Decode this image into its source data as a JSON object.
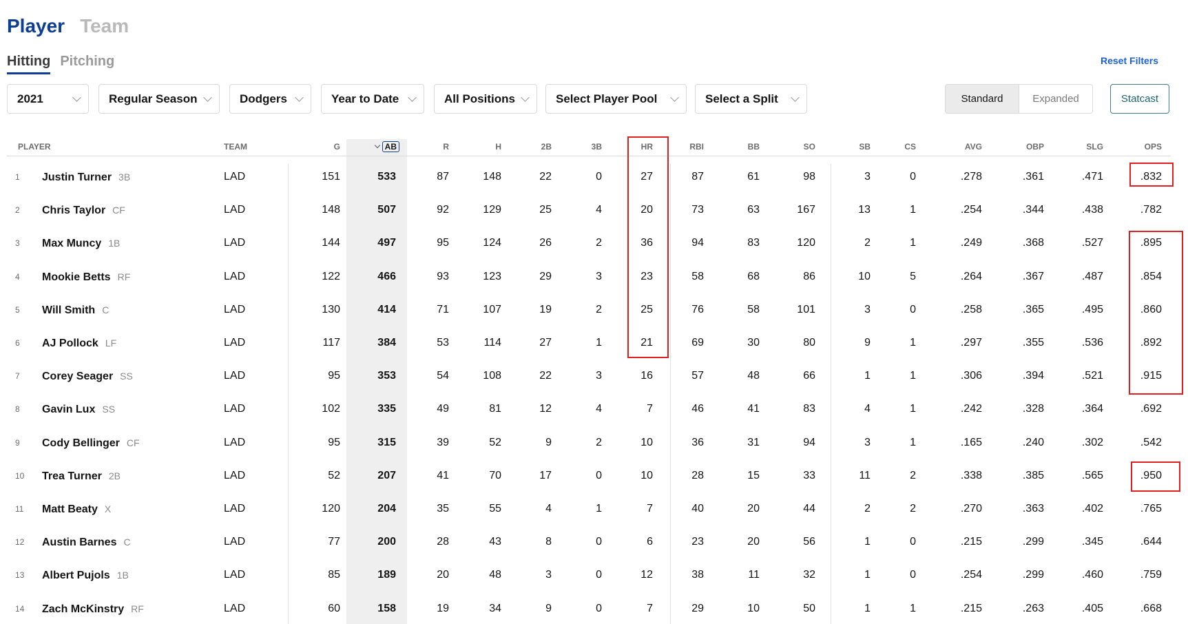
{
  "top_tabs": [
    {
      "label": "Player"
    },
    {
      "label": "Team"
    }
  ],
  "sub_tabs": [
    {
      "label": "Hitting"
    },
    {
      "label": "Pitching"
    }
  ],
  "reset_filters": "Reset Filters",
  "filters": [
    {
      "value": "2021"
    },
    {
      "value": "Regular Season"
    },
    {
      "value": "Dodgers"
    },
    {
      "value": "Year to Date"
    },
    {
      "value": "All Positions"
    },
    {
      "value": "Select Player Pool"
    },
    {
      "value": "Select a Split"
    }
  ],
  "view_toggle": {
    "standard": "Standard",
    "expanded": "Expanded"
  },
  "statcast": "Statcast",
  "columns": {
    "player": "PLAYER",
    "team": "TEAM",
    "g": "G",
    "ab": "AB",
    "r": "R",
    "h": "H",
    "doubles": "2B",
    "triples": "3B",
    "hr": "HR",
    "rbi": "RBI",
    "bb": "BB",
    "so": "SO",
    "sb": "SB",
    "cs": "CS",
    "avg": "AVG",
    "obp": "OBP",
    "slg": "SLG",
    "ops": "OPS"
  },
  "highlight_color": "#e02020",
  "accent_color": "#0d3e94",
  "rows": [
    {
      "rank": "1",
      "name": "Justin Turner",
      "pos": "3B",
      "team": "LAD",
      "g": "151",
      "ab": "533",
      "r": "87",
      "h": "148",
      "doubles": "22",
      "triples": "0",
      "hr": "27",
      "rbi": "87",
      "bb": "61",
      "so": "98",
      "sb": "3",
      "cs": "0",
      "avg": ".278",
      "obp": ".361",
      "slg": ".471",
      "ops": ".832"
    },
    {
      "rank": "2",
      "name": "Chris Taylor",
      "pos": "CF",
      "team": "LAD",
      "g": "148",
      "ab": "507",
      "r": "92",
      "h": "129",
      "doubles": "25",
      "triples": "4",
      "hr": "20",
      "rbi": "73",
      "bb": "63",
      "so": "167",
      "sb": "13",
      "cs": "1",
      "avg": ".254",
      "obp": ".344",
      "slg": ".438",
      "ops": ".782"
    },
    {
      "rank": "3",
      "name": "Max Muncy",
      "pos": "1B",
      "team": "LAD",
      "g": "144",
      "ab": "497",
      "r": "95",
      "h": "124",
      "doubles": "26",
      "triples": "2",
      "hr": "36",
      "rbi": "94",
      "bb": "83",
      "so": "120",
      "sb": "2",
      "cs": "1",
      "avg": ".249",
      "obp": ".368",
      "slg": ".527",
      "ops": ".895"
    },
    {
      "rank": "4",
      "name": "Mookie Betts",
      "pos": "RF",
      "team": "LAD",
      "g": "122",
      "ab": "466",
      "r": "93",
      "h": "123",
      "doubles": "29",
      "triples": "3",
      "hr": "23",
      "rbi": "58",
      "bb": "68",
      "so": "86",
      "sb": "10",
      "cs": "5",
      "avg": ".264",
      "obp": ".367",
      "slg": ".487",
      "ops": ".854"
    },
    {
      "rank": "5",
      "name": "Will Smith",
      "pos": "C",
      "team": "LAD",
      "g": "130",
      "ab": "414",
      "r": "71",
      "h": "107",
      "doubles": "19",
      "triples": "2",
      "hr": "25",
      "rbi": "76",
      "bb": "58",
      "so": "101",
      "sb": "3",
      "cs": "0",
      "avg": ".258",
      "obp": ".365",
      "slg": ".495",
      "ops": ".860"
    },
    {
      "rank": "6",
      "name": "AJ Pollock",
      "pos": "LF",
      "team": "LAD",
      "g": "117",
      "ab": "384",
      "r": "53",
      "h": "114",
      "doubles": "27",
      "triples": "1",
      "hr": "21",
      "rbi": "69",
      "bb": "30",
      "so": "80",
      "sb": "9",
      "cs": "1",
      "avg": ".297",
      "obp": ".355",
      "slg": ".536",
      "ops": ".892"
    },
    {
      "rank": "7",
      "name": "Corey Seager",
      "pos": "SS",
      "team": "LAD",
      "g": "95",
      "ab": "353",
      "r": "54",
      "h": "108",
      "doubles": "22",
      "triples": "3",
      "hr": "16",
      "rbi": "57",
      "bb": "48",
      "so": "66",
      "sb": "1",
      "cs": "1",
      "avg": ".306",
      "obp": ".394",
      "slg": ".521",
      "ops": ".915"
    },
    {
      "rank": "8",
      "name": "Gavin Lux",
      "pos": "SS",
      "team": "LAD",
      "g": "102",
      "ab": "335",
      "r": "49",
      "h": "81",
      "doubles": "12",
      "triples": "4",
      "hr": "7",
      "rbi": "46",
      "bb": "41",
      "so": "83",
      "sb": "4",
      "cs": "1",
      "avg": ".242",
      "obp": ".328",
      "slg": ".364",
      "ops": ".692"
    },
    {
      "rank": "9",
      "name": "Cody Bellinger",
      "pos": "CF",
      "team": "LAD",
      "g": "95",
      "ab": "315",
      "r": "39",
      "h": "52",
      "doubles": "9",
      "triples": "2",
      "hr": "10",
      "rbi": "36",
      "bb": "31",
      "so": "94",
      "sb": "3",
      "cs": "1",
      "avg": ".165",
      "obp": ".240",
      "slg": ".302",
      "ops": ".542"
    },
    {
      "rank": "10",
      "name": "Trea Turner",
      "pos": "2B",
      "team": "LAD",
      "g": "52",
      "ab": "207",
      "r": "41",
      "h": "70",
      "doubles": "17",
      "triples": "0",
      "hr": "10",
      "rbi": "28",
      "bb": "15",
      "so": "33",
      "sb": "11",
      "cs": "2",
      "avg": ".338",
      "obp": ".385",
      "slg": ".565",
      "ops": ".950"
    },
    {
      "rank": "11",
      "name": "Matt Beaty",
      "pos": "X",
      "team": "LAD",
      "g": "120",
      "ab": "204",
      "r": "35",
      "h": "55",
      "doubles": "4",
      "triples": "1",
      "hr": "7",
      "rbi": "40",
      "bb": "20",
      "so": "44",
      "sb": "2",
      "cs": "2",
      "avg": ".270",
      "obp": ".363",
      "slg": ".402",
      "ops": ".765"
    },
    {
      "rank": "12",
      "name": "Austin Barnes",
      "pos": "C",
      "team": "LAD",
      "g": "77",
      "ab": "200",
      "r": "28",
      "h": "43",
      "doubles": "8",
      "triples": "0",
      "hr": "6",
      "rbi": "23",
      "bb": "20",
      "so": "56",
      "sb": "1",
      "cs": "0",
      "avg": ".215",
      "obp": ".299",
      "slg": ".345",
      "ops": ".644"
    },
    {
      "rank": "13",
      "name": "Albert Pujols",
      "pos": "1B",
      "team": "LAD",
      "g": "85",
      "ab": "189",
      "r": "20",
      "h": "48",
      "doubles": "3",
      "triples": "0",
      "hr": "12",
      "rbi": "38",
      "bb": "11",
      "so": "32",
      "sb": "1",
      "cs": "0",
      "avg": ".254",
      "obp": ".299",
      "slg": ".460",
      "ops": ".759"
    },
    {
      "rank": "14",
      "name": "Zach McKinstry",
      "pos": "RF",
      "team": "LAD",
      "g": "60",
      "ab": "158",
      "r": "19",
      "h": "34",
      "doubles": "9",
      "triples": "0",
      "hr": "7",
      "rbi": "29",
      "bb": "10",
      "so": "50",
      "sb": "1",
      "cs": "1",
      "avg": ".215",
      "obp": ".263",
      "slg": ".405",
      "ops": ".668"
    }
  ]
}
